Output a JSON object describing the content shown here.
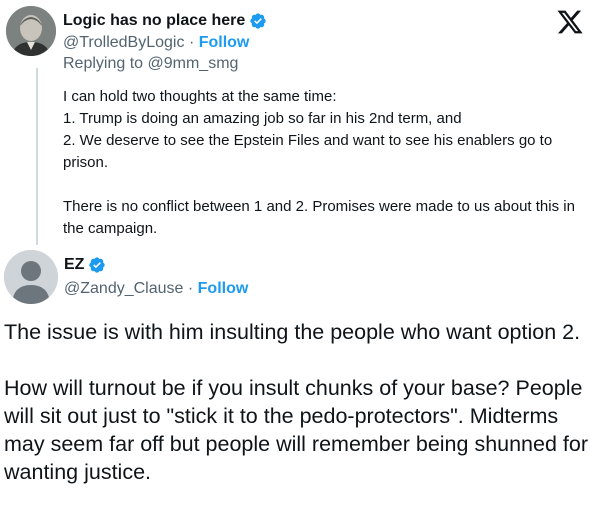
{
  "platform_logo": "X",
  "tweet": {
    "author_name": "Logic has no place here",
    "verified": true,
    "handle": "@TrolledByLogic",
    "separator": "·",
    "follow_label": "Follow",
    "replying_to": "Replying to @9mm_smg",
    "body": [
      "I can hold two thoughts at the same time:",
      "1. Trump is doing an amazing job so far in his 2nd term, and",
      "2. We deserve to see the Epstein Files and want to see his enablers go to prison.",
      "",
      "There is no conflict between 1 and 2. Promises were made to us about this in the campaign."
    ]
  },
  "reply": {
    "author_name": "EZ",
    "verified": true,
    "handle": "@Zandy_Clause",
    "separator": "·",
    "follow_label": "Follow",
    "body": [
      "The issue is with him insulting the people who want option 2.",
      "",
      "How will turnout be if you insult chunks of your base? People will sit out just to \"stick it to the pedo-protectors\". Midterms may seem far off but people will remember being shunned for wanting justice."
    ]
  },
  "colors": {
    "text": "#0f1419",
    "secondary": "#536471",
    "accent": "#1d9bf0",
    "thread_line": "#cfd9de"
  },
  "icons": [
    "x-logo-icon",
    "verified-badge-icon",
    "default-avatar-icon"
  ]
}
